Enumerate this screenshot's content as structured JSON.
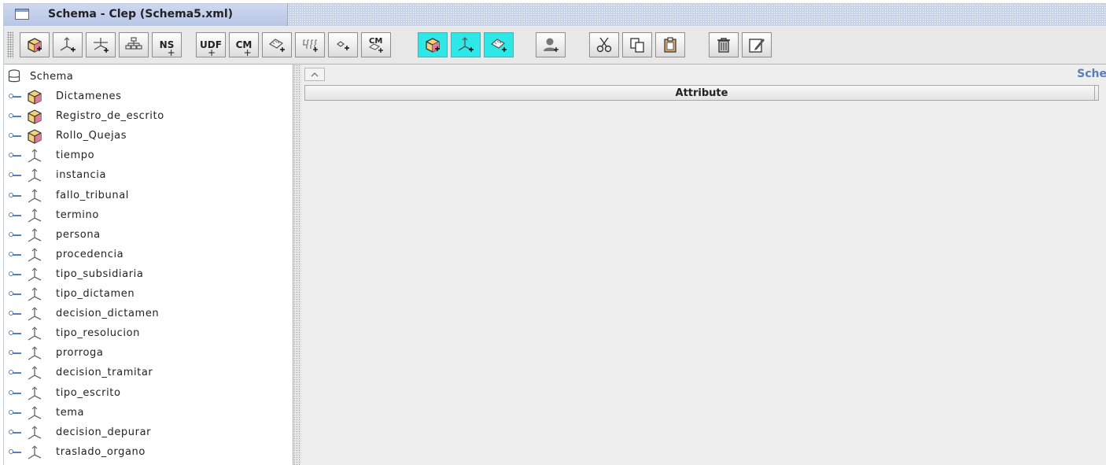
{
  "window": {
    "title": "Schema - Clep (Schema5.xml)",
    "accent_color": "#c9d3ea"
  },
  "toolbar": {
    "buttons": [
      {
        "icon": "add-cube-icon"
      },
      {
        "icon": "add-dimension-icon"
      },
      {
        "icon": "add-dimension-usage-icon"
      },
      {
        "icon": "add-hierarchy-icon"
      },
      {
        "icon": "add-named-set-icon",
        "label": "NS"
      },
      {
        "icon": "add-udf-icon",
        "label": "UDF"
      },
      {
        "icon": "add-calculated-member-icon",
        "label": "CM"
      },
      {
        "icon": "add-measure-icon"
      },
      {
        "icon": "add-level-icon"
      },
      {
        "icon": "add-property-icon"
      },
      {
        "icon": "add-calculated-measure-icon",
        "label": "CM"
      },
      {
        "icon": "add-virtual-cube-icon"
      },
      {
        "icon": "add-virtual-dimension-icon"
      },
      {
        "icon": "add-virtual-measure-icon"
      },
      {
        "icon": "add-role-icon"
      },
      {
        "icon": "cut-icon"
      },
      {
        "icon": "copy-icon"
      },
      {
        "icon": "paste-icon"
      },
      {
        "icon": "delete-icon"
      },
      {
        "icon": "edit-icon"
      }
    ]
  },
  "tree": {
    "root_label": "Schema",
    "items": [
      {
        "label": "Dictamenes",
        "type": "cube"
      },
      {
        "label": "Registro_de_escrito",
        "type": "cube"
      },
      {
        "label": "Rollo_Quejas",
        "type": "cube"
      },
      {
        "label": "tiempo",
        "type": "dimension"
      },
      {
        "label": "instancia",
        "type": "dimension"
      },
      {
        "label": "fallo_tribunal",
        "type": "dimension"
      },
      {
        "label": "termino",
        "type": "dimension"
      },
      {
        "label": "persona",
        "type": "dimension"
      },
      {
        "label": "procedencia",
        "type": "dimension"
      },
      {
        "label": "tipo_subsidiaria",
        "type": "dimension"
      },
      {
        "label": "tipo_dictamen",
        "type": "dimension"
      },
      {
        "label": "decision_dictamen",
        "type": "dimension"
      },
      {
        "label": "tipo_resolucion",
        "type": "dimension"
      },
      {
        "label": "prorroga",
        "type": "dimension"
      },
      {
        "label": "decision_tramitar",
        "type": "dimension"
      },
      {
        "label": "tipo_escrito",
        "type": "dimension"
      },
      {
        "label": "tema",
        "type": "dimension"
      },
      {
        "label": "decision_depurar",
        "type": "dimension"
      },
      {
        "label": "traslado_organo",
        "type": "dimension"
      }
    ]
  },
  "right_panel": {
    "title": "Sche",
    "column_header": "Attribute"
  }
}
